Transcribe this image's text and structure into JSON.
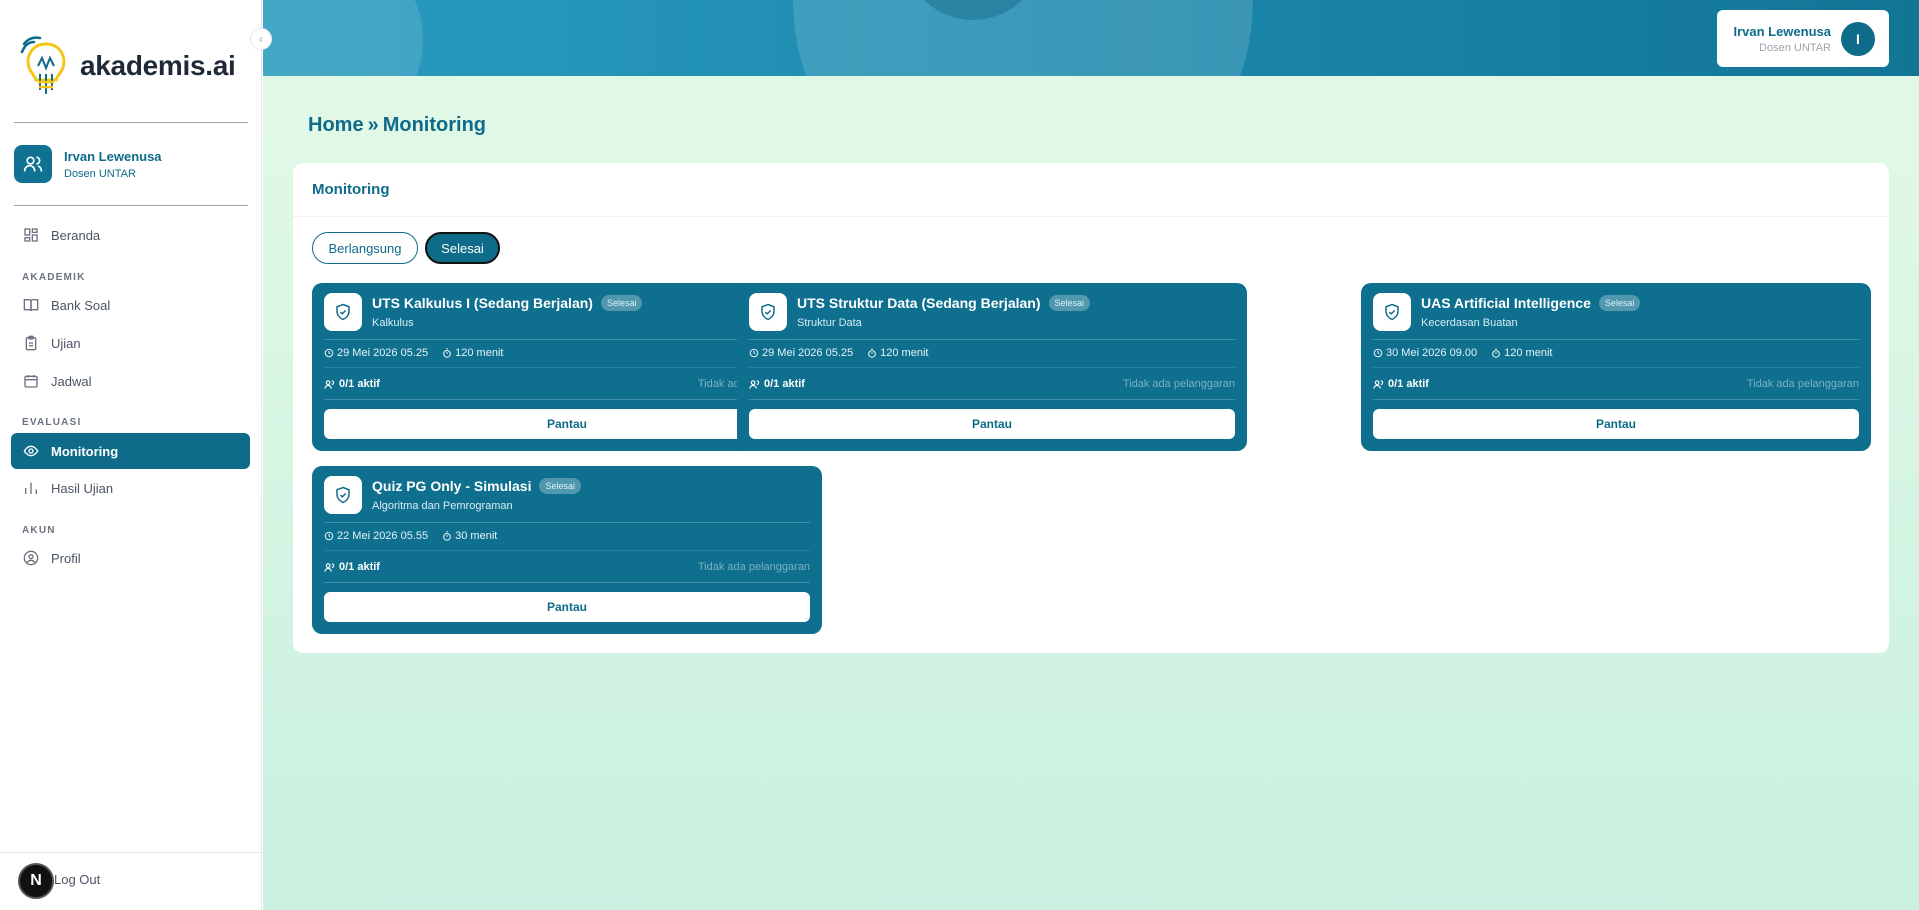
{
  "brand": {
    "name": "akademis.ai"
  },
  "sidebar": {
    "user": {
      "name": "Irvan Lewenusa",
      "role": "Dosen UNTAR"
    },
    "items": [
      {
        "label": "Beranda"
      },
      {
        "label": "Bank Soal"
      },
      {
        "label": "Ujian"
      },
      {
        "label": "Jadwal"
      },
      {
        "label": "Monitoring"
      },
      {
        "label": "Hasil Ujian"
      },
      {
        "label": "Profil"
      }
    ],
    "sections": [
      "AKADEMIK",
      "EVALUASI",
      "AKUN"
    ],
    "logout_label": "Log Out",
    "logout_badge": "N"
  },
  "header": {
    "user": {
      "name": "Irvan Lewenusa",
      "role": "Dosen UNTAR",
      "initial": "I"
    }
  },
  "breadcrumb": {
    "home": "Home",
    "separator": "»",
    "current": "Monitoring"
  },
  "panel": {
    "title": "Monitoring",
    "tabs": [
      {
        "label": "Berlangsung"
      },
      {
        "label": "Selesai"
      }
    ],
    "cards": [
      {
        "title": "UTS Kalkulus I (Sedang Berjalan)",
        "badge": "Selesai",
        "subject": "Kalkulus",
        "datetime": "29 Mei 2026 05.25",
        "duration": "120 menit",
        "active": "0/1 aktif",
        "violations": "Tidak ada pelanggaran",
        "button": "Pantau"
      },
      {
        "title": "UTS Struktur Data (Sedang Berjalan)",
        "badge": "Selesai",
        "subject": "Struktur Data",
        "datetime": "29 Mei 2026 05.25",
        "duration": "120 menit",
        "active": "0/1 aktif",
        "violations": "Tidak ada pelanggaran",
        "button": "Pantau"
      },
      {
        "title": "UAS Artificial Intelligence",
        "badge": "Selesai",
        "subject": "Kecerdasan Buatan",
        "datetime": "30 Mei 2026 09.00",
        "duration": "120 menit",
        "active": "0/1 aktif",
        "violations": "Tidak ada pelanggaran",
        "button": "Pantau"
      },
      {
        "title": "Quiz PG Only - Simulasi",
        "badge": "Selesai",
        "subject": "Algoritma dan Pemrograman",
        "datetime": "22 Mei 2026 05.55",
        "duration": "30 menit",
        "active": "0/1 aktif",
        "violations": "Tidak ada pelanggaran",
        "button": "Pantau"
      }
    ]
  },
  "colors": {
    "primary": "#0f6b8a",
    "card": "#0e6f8f",
    "bulb": "#f5c518"
  }
}
